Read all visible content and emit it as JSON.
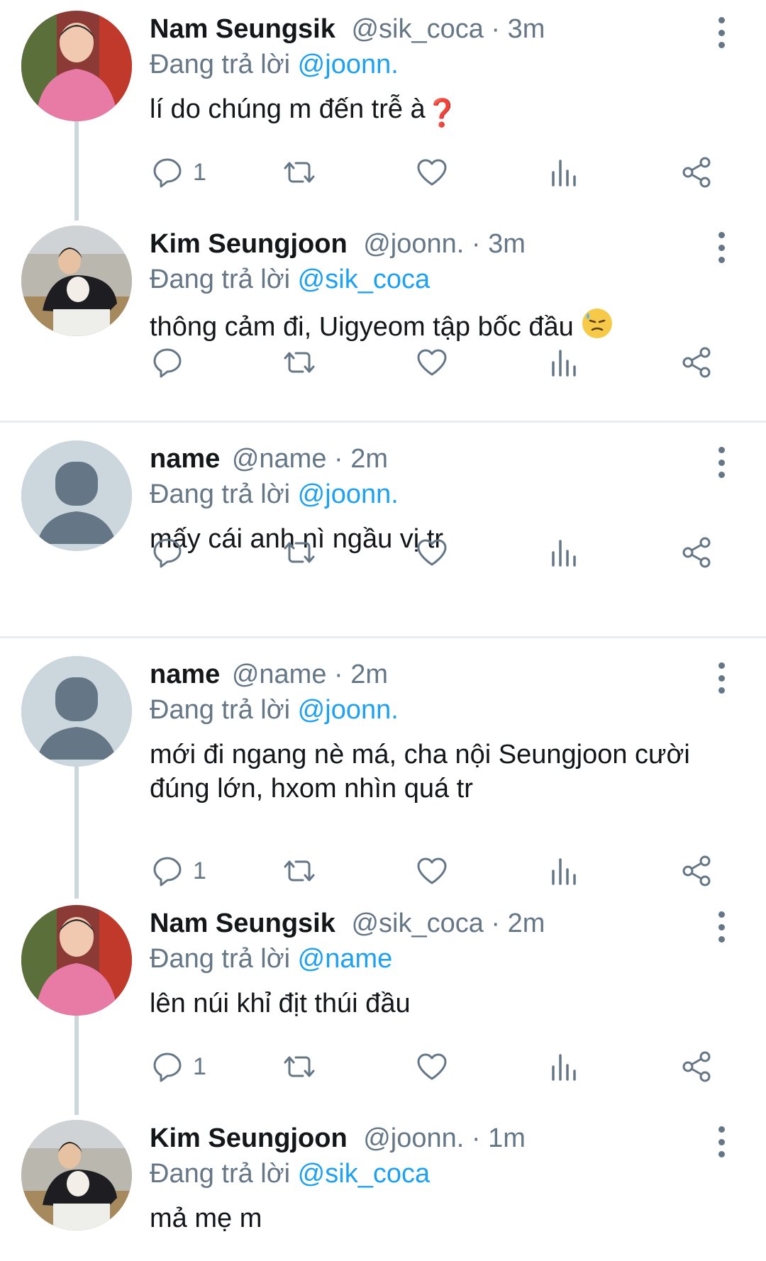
{
  "icons": {
    "reply": "reply-icon",
    "retweet": "retweet-icon",
    "like": "heart-icon",
    "analytics": "analytics-icon",
    "share": "share-icon",
    "more": "more-vertical-icon"
  },
  "colors": {
    "mention": "#1da1f2",
    "secondary_text": "#657786",
    "icon": "#657786",
    "divider": "#e6ecf0",
    "thread_line": "#ccd6dd"
  },
  "tweets": [
    {
      "name": "Nam Seungsik",
      "handle": "@sik_coca",
      "sep": "·",
      "time": "3m",
      "reply_prefix": "Đang trả lời",
      "reply_to": "@joonn.",
      "text": "lí do chúng m đến trễ à",
      "emoji": "❓",
      "reply_count": "1"
    },
    {
      "name": "Kim Seungjoon",
      "handle": "@joonn.",
      "sep": "·",
      "time": "3m",
      "reply_prefix": "Đang trả lời",
      "reply_to": "@sik_coca",
      "text": "thông cảm đi, Uigyeom tập bốc đầu",
      "emoji": "😓",
      "reply_count": ""
    },
    {
      "name": "name",
      "handle": "@name",
      "sep": "·",
      "time": "2m",
      "reply_prefix": "Đang trả lời",
      "reply_to": "@joonn.",
      "text": "mấy cái anh nì ngầu vị tr",
      "emoji": "",
      "reply_count": ""
    },
    {
      "name": "name",
      "handle": "@name",
      "sep": "·",
      "time": "2m",
      "reply_prefix": "Đang trả lời",
      "reply_to": "@joonn.",
      "text": "mới đi ngang nè má, cha nội Seungjoon cười đúng lớn, hxom nhìn quá tr",
      "emoji": "",
      "reply_count": "1"
    },
    {
      "name": "Nam Seungsik",
      "handle": "@sik_coca",
      "sep": "·",
      "time": "2m",
      "reply_prefix": "Đang trả lời",
      "reply_to": "@name",
      "text": "lên núi khỉ địt thúi đầu",
      "emoji": "",
      "reply_count": "1"
    },
    {
      "name": "Kim Seungjoon",
      "handle": "@joonn.",
      "sep": "·",
      "time": "1m",
      "reply_prefix": "Đang trả lời",
      "reply_to": "@sik_coca",
      "text": "mả mẹ m",
      "emoji": "",
      "reply_count": ""
    }
  ]
}
